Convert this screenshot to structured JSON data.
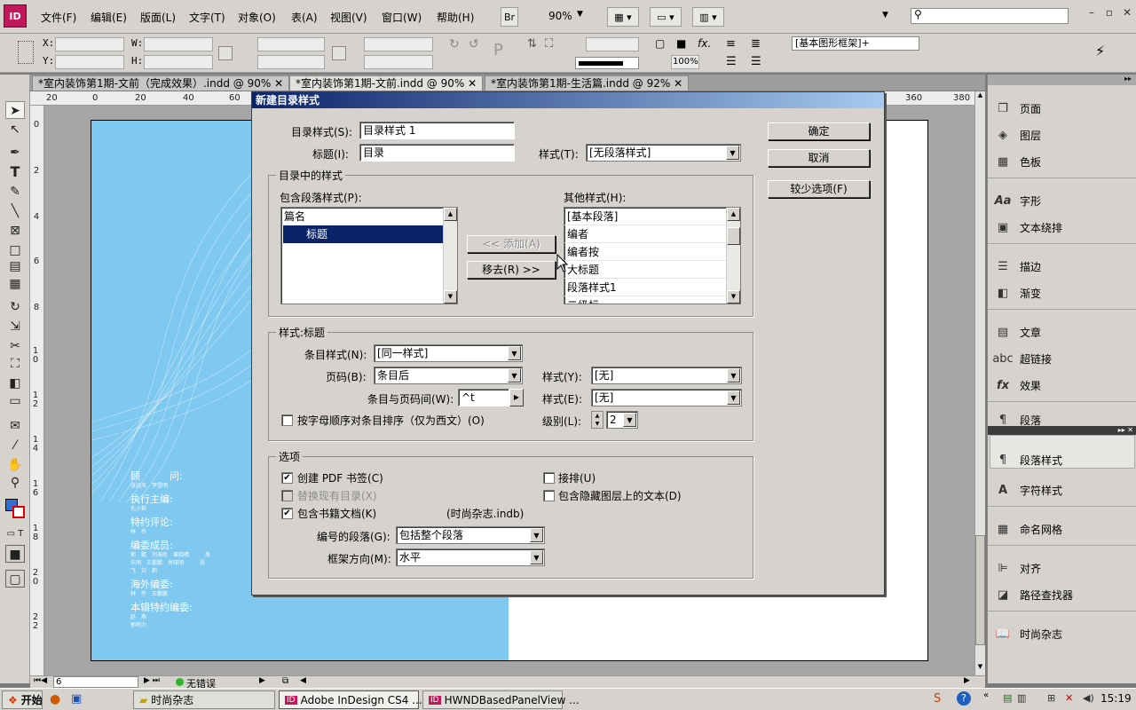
{
  "app": {
    "icon_text": "ID"
  },
  "menu": [
    "文件(F)",
    "编辑(E)",
    "版面(L)",
    "文字(T)",
    "对象(O)",
    "表(A)",
    "视图(V)",
    "窗口(W)",
    "帮助(H)"
  ],
  "toolbar": {
    "bridge": "Br",
    "zoom": "90%"
  },
  "control": {
    "x_label": "X:",
    "y_label": "Y:",
    "w_label": "W:",
    "h_label": "H:",
    "percent": "100%",
    "frame_style": "[基本图形框架]+"
  },
  "tabs": [
    {
      "label": "*室内装饰第1期-文前（完成效果）.indd @ 90%"
    },
    {
      "label": "*室内装饰第1期-文前.indd @ 90%"
    },
    {
      "label": "*室内装饰第1期-生活篇.indd @ 92%"
    }
  ],
  "ruler": {
    "h": [
      "20",
      "0",
      "20",
      "40",
      "60",
      "360",
      "380"
    ],
    "v": [
      "0",
      "2",
      "4",
      "6",
      "8",
      "1 0",
      "1 2",
      "1 4",
      "1 6",
      "1 8",
      "2 0",
      "2 2",
      "2 4",
      "2 6"
    ]
  },
  "credits": [
    {
      "h": "顾　　　问:",
      "s": "张远天　李雪明"
    },
    {
      "h": "执行主编:",
      "s": "孔小莉"
    },
    {
      "h": "特约评论:",
      "s": "林　乔"
    },
    {
      "h": "编委成员:",
      "s": "郭　鹏　刘海民　黄晓晴　　　美乐明　王鹏鹏　肖晓明　　　张　飞　刘　莉"
    },
    {
      "h": "海外编委:",
      "s": "林　乔　王鹏鹏"
    },
    {
      "h": "本辑特约编委:",
      "s": "赵　燕　　　郭雨力"
    }
  ],
  "status": {
    "page": "6",
    "error": "无错误"
  },
  "panel": {
    "items": [
      "页面",
      "图层",
      "色板",
      "字形",
      "文本绕排",
      "描边",
      "渐变",
      "文章",
      "超链接",
      "效果",
      "段落",
      "段落样式",
      "字符样式",
      "命名网格",
      "对齐",
      "路径查找器",
      "时尚杂志"
    ]
  },
  "dialog": {
    "title": "新建目录样式",
    "toc_style_label": "目录样式(S):",
    "toc_style_value": "目录样式 1",
    "title_label": "标题(I):",
    "title_value": "目录",
    "style_label": "样式(T):",
    "style_value": "[无段落样式]",
    "ok": "确定",
    "cancel": "取消",
    "fewer_options": "较少选项(F)",
    "group_styles": "目录中的样式",
    "include_label": "包含段落样式(P):",
    "include_items": [
      "篇名",
      "标题"
    ],
    "other_label": "其他样式(H):",
    "other_items": [
      "[基本段落]",
      "编者",
      "编者按",
      "大标题",
      "段落样式1",
      "二级标"
    ],
    "add_btn": "<< 添加(A)",
    "remove_btn": "移去(R) >>",
    "group_style_title": "样式:标题",
    "entry_style_label": "条目样式(N):",
    "entry_style_value": "[同一样式]",
    "page_number_label": "页码(B):",
    "page_number_value": "条目后",
    "page_style_label": "样式(Y):",
    "page_style_value": "[无]",
    "between_label": "条目与页码间(W):",
    "between_value": "^t",
    "between_style_label": "样式(E):",
    "between_style_value": "[无]",
    "sort_label": "按字母顺序对条目排序（仅为西文）(O)",
    "level_label": "级别(L):",
    "level_value": "2",
    "group_options": "选项",
    "opt_pdf": "创建 PDF 书签(C)",
    "opt_replace": "替换现有目录(X)",
    "opt_book": "包含书籍文档(K)",
    "book_name": "(时尚杂志.indb)",
    "opt_runin": "接排(U)",
    "opt_hidden": "包含隐藏图层上的文本(D)",
    "numbered_label": "编号的段落(G):",
    "numbered_value": "包括整个段落",
    "frame_dir_label": "框架方向(M):",
    "frame_dir_value": "水平"
  },
  "taskbar": {
    "start": "开始",
    "items": [
      "时尚杂志",
      "Adobe InDesign CS4 ...",
      "HWNDBasedPanelView ..."
    ],
    "clock": "15:19"
  }
}
